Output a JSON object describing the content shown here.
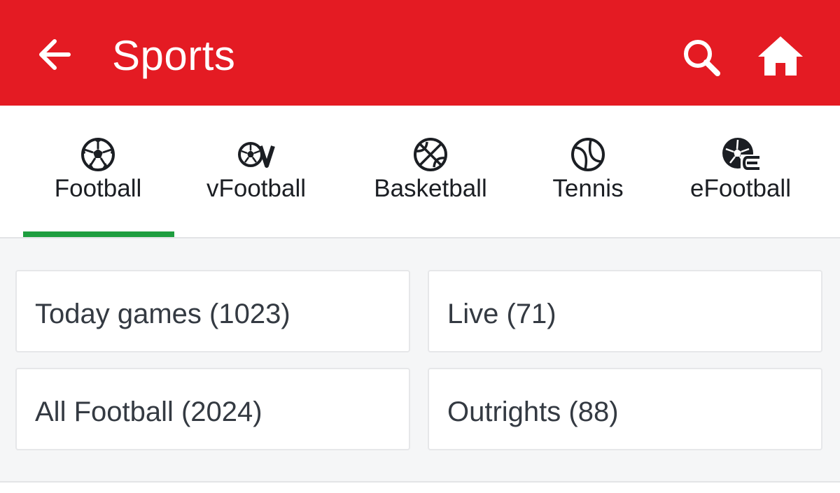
{
  "header": {
    "title": "Sports",
    "back_icon": "arrow-left-icon",
    "search_icon": "search-icon",
    "home_icon": "home-icon",
    "background_color": "#e41b23"
  },
  "sport_tabs": [
    {
      "label": "Football",
      "icon": "soccer-ball-icon",
      "selected": true
    },
    {
      "label": "vFootball",
      "icon": "virtual-football-icon",
      "selected": false
    },
    {
      "label": "Basketball",
      "icon": "basketball-icon",
      "selected": false
    },
    {
      "label": "Tennis",
      "icon": "tennis-ball-icon",
      "selected": false
    },
    {
      "label": "eFootball",
      "icon": "efootball-icon",
      "selected": false
    }
  ],
  "active_tab_indicator_color": "#1e9e3f",
  "categories": [
    {
      "label": "Today games (1023)"
    },
    {
      "label": "Live (71)"
    },
    {
      "label": "All Football (2024)"
    },
    {
      "label": "Outrights (88)"
    }
  ]
}
